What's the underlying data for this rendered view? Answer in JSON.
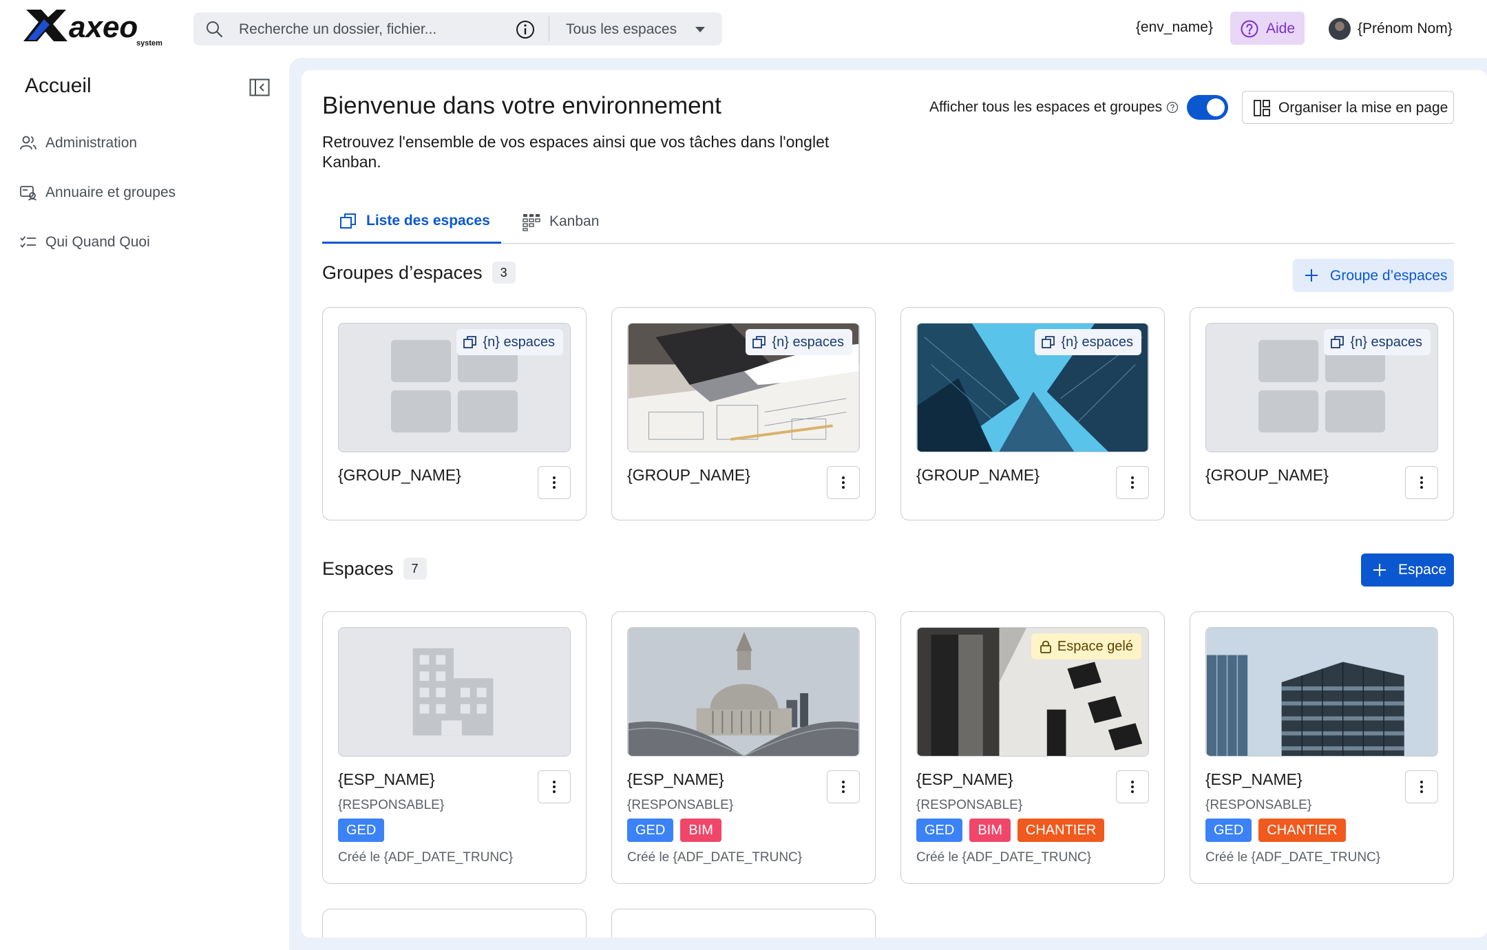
{
  "header": {
    "search_placeholder": "Recherche un dossier, fichier...",
    "scope": "Tous les espaces",
    "env_name": "{env_name}",
    "aide": "Aide",
    "user_name": "{Prénom Nom}"
  },
  "sidebar": {
    "title": "Accueil",
    "items": [
      {
        "label": "Administration",
        "icon": "users-icon"
      },
      {
        "label": "Annuaire et groupes",
        "icon": "contact-card-icon"
      },
      {
        "label": "Qui Quand Quoi",
        "icon": "checklist-icon"
      }
    ]
  },
  "main": {
    "welcome": "Bienvenue dans votre environnement",
    "subtitle": "Retrouvez l'ensemble de vos espaces ainsi que vos tâches dans l'onglet Kanban.",
    "toggle_label": "Afficher tous les espaces et groupes",
    "toggle_on": true,
    "organize_label": "Organiser la mise en page",
    "tabs": [
      {
        "label": "Liste des espaces",
        "active": true
      },
      {
        "label": "Kanban",
        "active": false
      }
    ]
  },
  "groups": {
    "title": "Groupes d’espaces",
    "count": "3",
    "add_label": "Groupe d’espaces",
    "items": [
      {
        "name": "{GROUP_NAME}",
        "badge": "{n} espaces",
        "image": "placeholder-grid"
      },
      {
        "name": "{GROUP_NAME}",
        "badge": "{n} espaces",
        "image": "laptop-blueprints"
      },
      {
        "name": "{GROUP_NAME}",
        "badge": "{n} espaces",
        "image": "skyscrapers"
      },
      {
        "name": "{GROUP_NAME}",
        "badge": "{n} espaces",
        "image": "placeholder-grid"
      }
    ]
  },
  "spaces": {
    "title": "Espaces",
    "count": "7",
    "add_label": "Espace",
    "items": [
      {
        "name": "{ESP_NAME}",
        "responsable": "{RESPONSABLE}",
        "tags": [
          "GED"
        ],
        "date": "Créé le {ADF_DATE_TRUNC}",
        "image": "placeholder-building",
        "frozen": ""
      },
      {
        "name": "{ESP_NAME}",
        "responsable": "{RESPONSABLE}",
        "tags": [
          "GED",
          "BIM"
        ],
        "date": "Créé le {ADF_DATE_TRUNC}",
        "image": "cathedral-dome",
        "frozen": ""
      },
      {
        "name": "{ESP_NAME}",
        "responsable": "{RESPONSABLE}",
        "tags": [
          "GED",
          "BIM",
          "CHANTIER"
        ],
        "date": "Créé le {ADF_DATE_TRUNC}",
        "image": "facade-windows",
        "frozen": "Espace gelé"
      },
      {
        "name": "{ESP_NAME}",
        "responsable": "{RESPONSABLE}",
        "tags": [
          "GED",
          "CHANTIER"
        ],
        "date": "Créé le {ADF_DATE_TRUNC}",
        "image": "glass-tower",
        "frozen": ""
      }
    ]
  },
  "colors": {
    "primary": "#0b57d0",
    "tag_GED": "#3b82f6",
    "tag_BIM": "#f0466a",
    "tag_CHANTIER": "#f05a1e",
    "aide_bg": "#e8d7f7",
    "frozen_bg": "#fff3c8"
  }
}
